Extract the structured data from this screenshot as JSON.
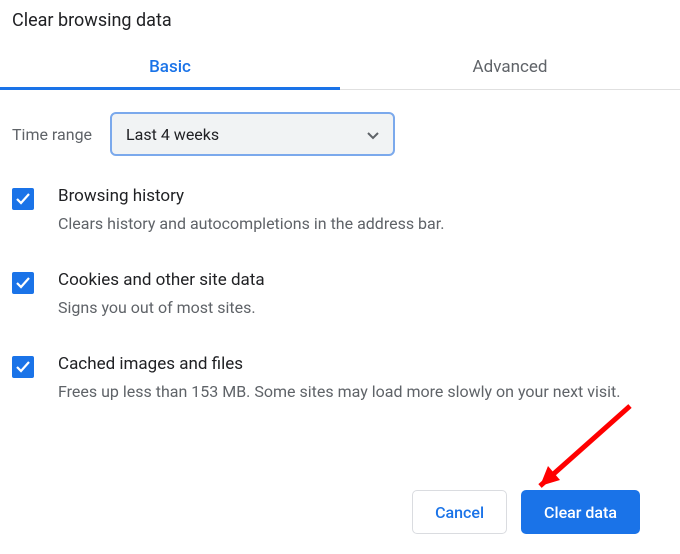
{
  "dialog": {
    "title": "Clear browsing data",
    "tabs": {
      "basic": "Basic",
      "advanced": "Advanced"
    },
    "timerange": {
      "label": "Time range",
      "selected": "Last 4 weeks"
    },
    "options": [
      {
        "title": "Browsing history",
        "desc": "Clears history and autocompletions in the address bar."
      },
      {
        "title": "Cookies and other site data",
        "desc": "Signs you out of most sites."
      },
      {
        "title": "Cached images and files",
        "desc": "Frees up less than 153 MB. Some sites may load more slowly on your next visit."
      }
    ],
    "buttons": {
      "cancel": "Cancel",
      "clear": "Clear data"
    }
  }
}
